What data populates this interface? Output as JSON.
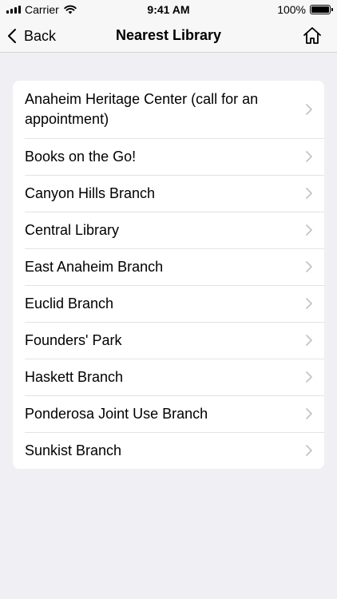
{
  "status": {
    "carrier": "Carrier",
    "time": "9:41 AM",
    "battery": "100%",
    "battery_level": 1.0
  },
  "nav": {
    "back_label": "Back",
    "title": "Nearest Library",
    "home_icon": "home-icon"
  },
  "libraries": [
    "Anaheim Heritage Center (call for an appointment)",
    "Books on the Go!",
    "Canyon Hills Branch",
    "Central Library",
    "East Anaheim Branch",
    "Euclid Branch",
    "Founders' Park",
    "Haskett Branch",
    "Ponderosa Joint Use Branch",
    "Sunkist Branch"
  ]
}
